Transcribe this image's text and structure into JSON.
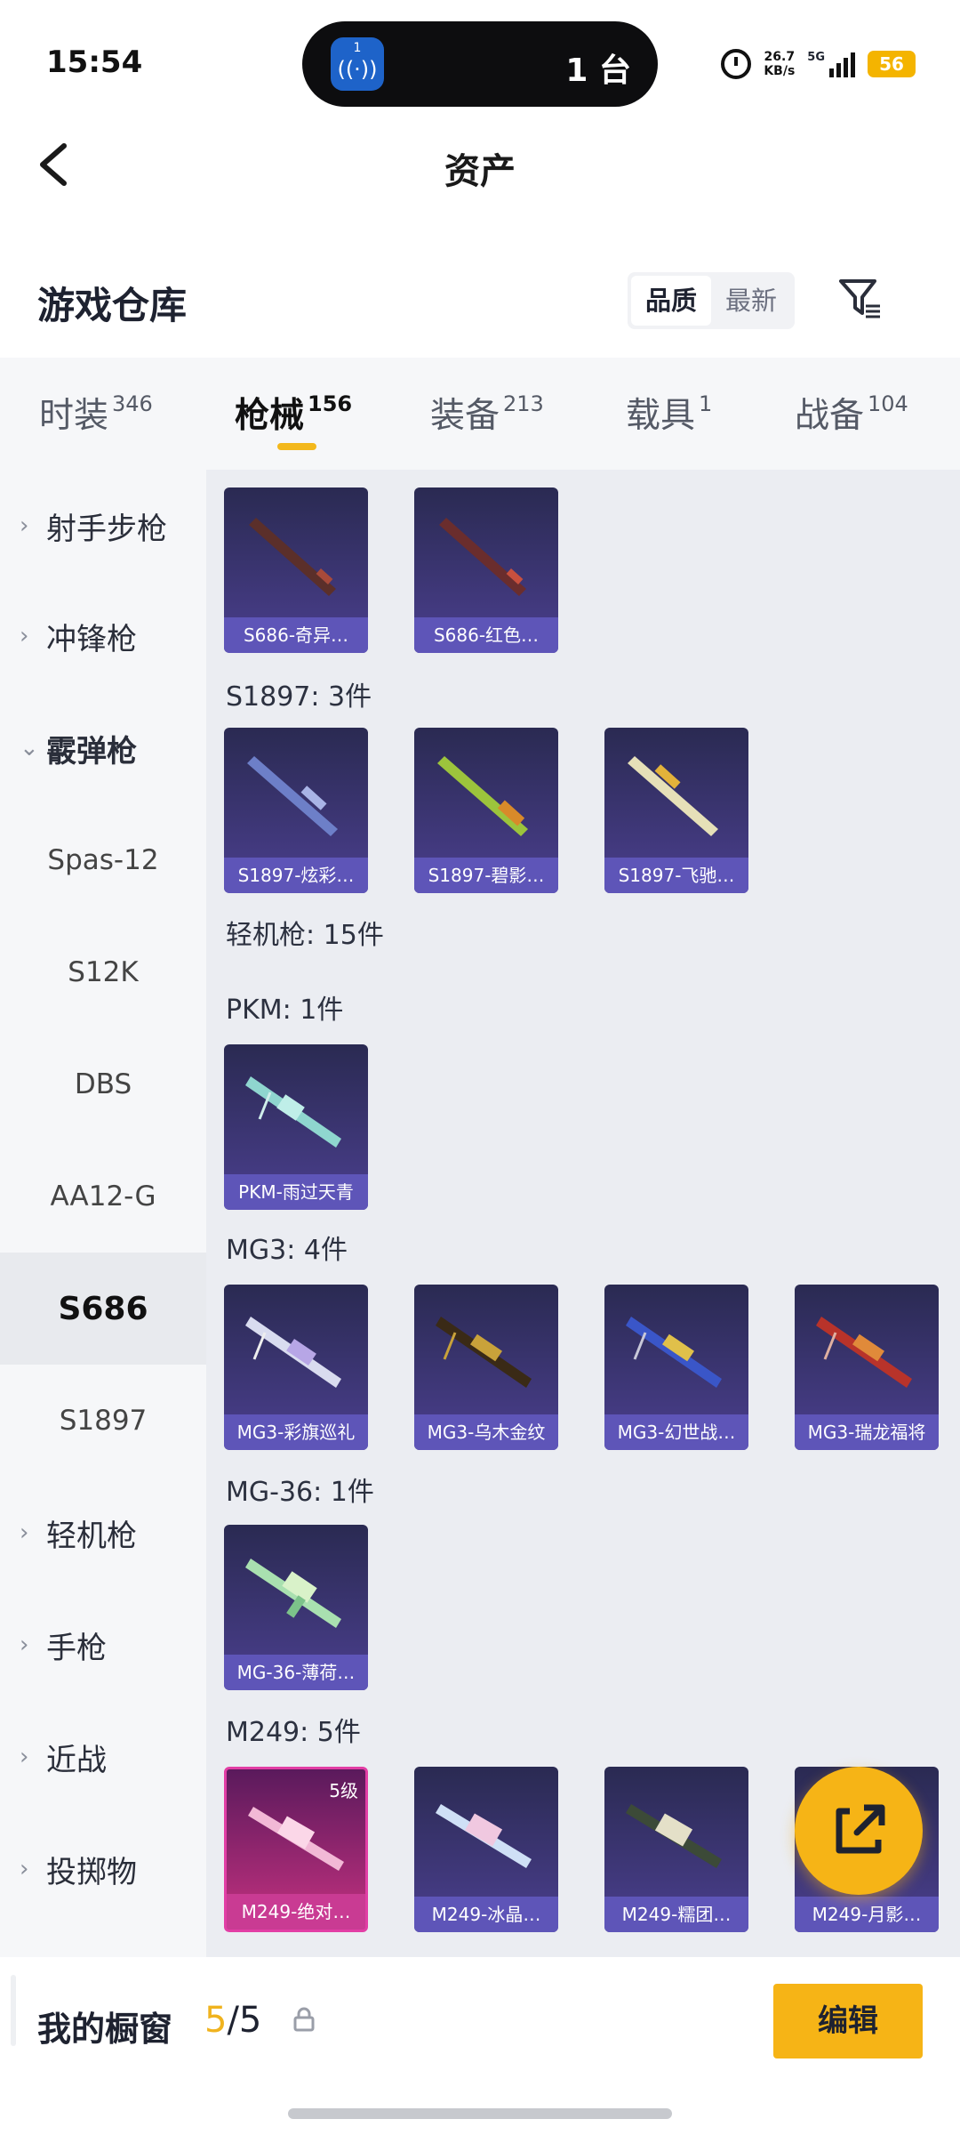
{
  "status_bar": {
    "time": "15:54",
    "island_badge": "1",
    "island_text": "1 台",
    "net_speed_value": "26.7",
    "net_speed_unit": "KB/s",
    "network": "5G",
    "battery": "56",
    "icons": [
      "alarm-icon",
      "signal-icon",
      "battery-icon"
    ]
  },
  "header": {
    "title": "资产",
    "back_icon": "chevron-left-icon"
  },
  "warehouse": {
    "title": "游戏仓库",
    "sort_options": [
      "品质",
      "最新"
    ],
    "sort_selected": "品质",
    "filter_icon": "filter-icon"
  },
  "tabs": [
    {
      "label": "时装",
      "count": "346"
    },
    {
      "label": "枪械",
      "count": "156",
      "active": true
    },
    {
      "label": "装备",
      "count": "213"
    },
    {
      "label": "载具",
      "count": "1"
    },
    {
      "label": "战备",
      "count": "104"
    }
  ],
  "sidebar": {
    "items": [
      {
        "label": "射手步枪",
        "chevron": "›"
      },
      {
        "label": "冲锋枪",
        "chevron": "›"
      },
      {
        "label": "霰弹枪",
        "chevron": "⌄",
        "expanded": true
      },
      {
        "label": "Spas-12"
      },
      {
        "label": "S12K"
      },
      {
        "label": "DBS"
      },
      {
        "label": "AA12-G"
      },
      {
        "label": "S686",
        "selected": true
      },
      {
        "label": "S1897"
      },
      {
        "label": "轻机枪",
        "chevron": "›"
      },
      {
        "label": "手枪",
        "chevron": "›"
      },
      {
        "label": "近战",
        "chevron": "›"
      },
      {
        "label": "投掷物",
        "chevron": "›"
      }
    ]
  },
  "content": {
    "groups": [
      {
        "label": "",
        "items": [
          "S686-奇异…",
          "S686-红色…"
        ]
      },
      {
        "label": "S1897: 3件",
        "items": [
          "S1897-炫彩…",
          "S1897-碧影…",
          "S1897-飞驰…"
        ]
      },
      {
        "label": "轻机枪: 15件",
        "items": []
      },
      {
        "label": "PKM: 1件",
        "items": [
          "PKM-雨过天青"
        ]
      },
      {
        "label": "MG3: 4件",
        "items": [
          "MG3-彩旗巡礼",
          "MG3-乌木金纹",
          "MG3-幻世战…",
          "MG3-瑞龙福将"
        ]
      },
      {
        "label": "MG-36: 1件",
        "items": [
          "MG-36-薄荷…"
        ]
      },
      {
        "label": "M249: 5件",
        "items": [
          "M249-绝对…",
          "M249-冰晶…",
          "M249-糯团…",
          "M249-月影…"
        ]
      }
    ],
    "level_badge": "5级",
    "share_icon": "share-icon"
  },
  "bottom": {
    "showcase_label": "我的橱窗",
    "showcase_current": "5",
    "showcase_total": "/5",
    "lock_icon": "lock-icon",
    "edit_label": "编辑"
  },
  "colors": {
    "accent": "#f6b416",
    "card_bg": "#3b3478",
    "card_caption": "#5e55b8",
    "rare_card": "#c93b93"
  }
}
